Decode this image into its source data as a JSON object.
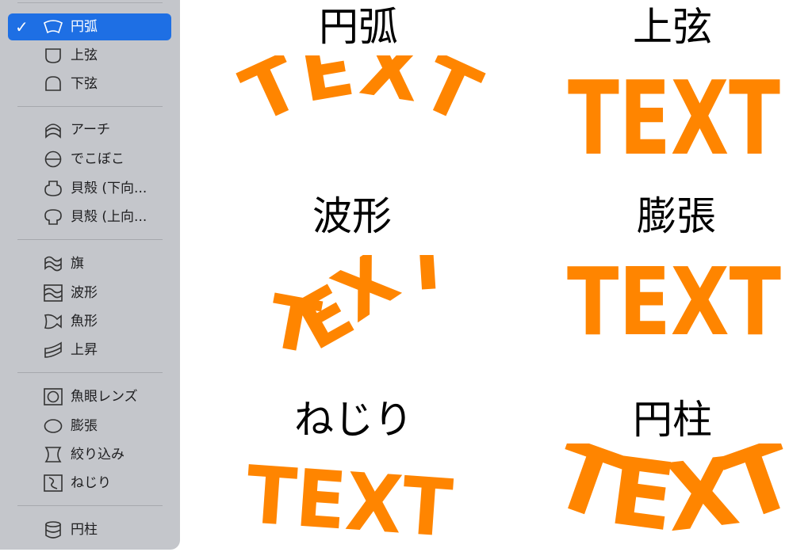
{
  "menu": {
    "check": "✓",
    "items": [
      {
        "label": "円弧",
        "icon": "arc-icon",
        "selected": true
      },
      {
        "label": "上弦",
        "icon": "arch-up-icon"
      },
      {
        "label": "下弦",
        "icon": "arch-down-icon"
      },
      {
        "label": "アーチ",
        "icon": "arch-icon"
      },
      {
        "label": "でこぼこ",
        "icon": "bulge-icon"
      },
      {
        "label": "貝殻 (下向...",
        "icon": "shell-lower-icon"
      },
      {
        "label": "貝殻 (上向...",
        "icon": "shell-upper-icon"
      },
      {
        "label": "旗",
        "icon": "flag-icon"
      },
      {
        "label": "波形",
        "icon": "wave-icon"
      },
      {
        "label": "魚形",
        "icon": "fish-icon"
      },
      {
        "label": "上昇",
        "icon": "rise-icon"
      },
      {
        "label": "魚眼レンズ",
        "icon": "fisheye-icon"
      },
      {
        "label": "膨張",
        "icon": "inflate-icon"
      },
      {
        "label": "絞り込み",
        "icon": "squeeze-icon"
      },
      {
        "label": "ねじり",
        "icon": "twist-icon"
      },
      {
        "label": "円柱",
        "icon": "cylinder-icon"
      }
    ]
  },
  "previews": [
    {
      "title": "円弧",
      "text": "TEXT"
    },
    {
      "title": "上弦",
      "text": "TEXT"
    },
    {
      "title": "波形",
      "text": "TEXT"
    },
    {
      "title": "膨張",
      "text": "TEXT"
    },
    {
      "title": "ねじり",
      "text": "TEXT"
    },
    {
      "title": "円柱",
      "text": "TEXT"
    }
  ],
  "colors": {
    "text_effect": "#ff8500",
    "selection": "#1e6fe4",
    "menu_bg": "#c4c6cb"
  }
}
